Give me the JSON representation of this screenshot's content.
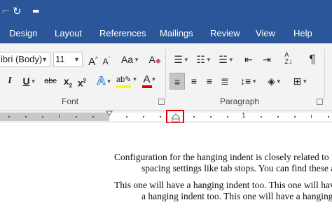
{
  "quick_access": {
    "redo_icon": "redo-icon",
    "customize_icon": "customize-qat-icon"
  },
  "tabs": [
    "Design",
    "Layout",
    "References",
    "Mailings",
    "Review",
    "View",
    "Help"
  ],
  "font": {
    "name": "ibri (Body)",
    "size": "11",
    "group_label": "Font",
    "buttons": {
      "grow": "A",
      "shrink": "A",
      "case": "Aa",
      "clear": "A",
      "italic": "I",
      "underline": "U",
      "strikethrough": "abc",
      "subscript": "x",
      "subscript_mark": "2",
      "superscript": "x",
      "superscript_mark": "2",
      "text_effects": "A",
      "highlight": "ab",
      "font_color": "A"
    },
    "colors": {
      "highlight": "#ffff00",
      "font_color": "#e00000",
      "text_effects": "#2b7cd3"
    }
  },
  "paragraph": {
    "group_label": "Paragraph",
    "show_marks": "¶",
    "active_alignment": "align-left"
  },
  "ruler": {
    "number_label": "1"
  },
  "document": {
    "lines": [
      "Configuration for the hanging indent is closely related to \"s",
      "spacing settings like tab stops. You can find these a",
      "This one will have a hanging indent too. This one will have",
      "a hanging indent too. This one will have a hanging i"
    ]
  },
  "colors": {
    "ribbon_blue": "#2b579a",
    "highlight_box": "#e00000"
  }
}
